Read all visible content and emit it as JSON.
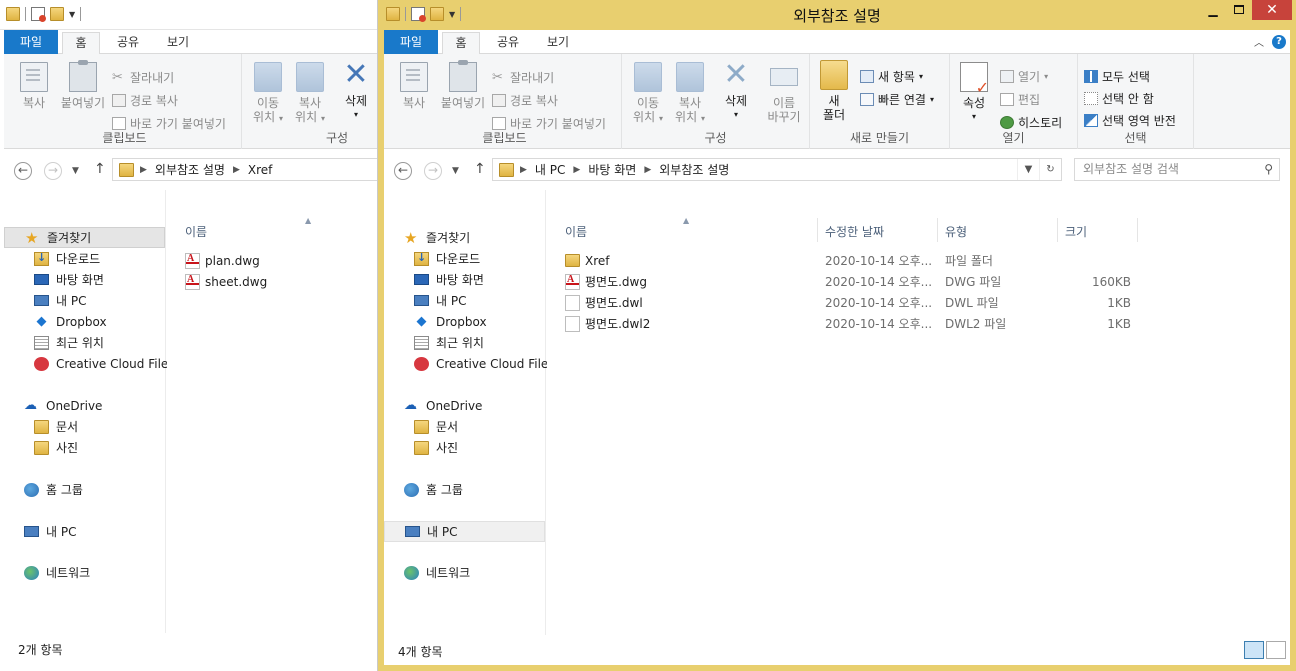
{
  "left_window": {
    "tabs": [
      "파일",
      "홈",
      "공유",
      "보기"
    ],
    "ribbon": {
      "clipboard": {
        "copy": "복사",
        "paste": "붙여넣기",
        "cut": "잘라내기",
        "copy_path": "경로 복사",
        "paste_shortcut": "바로 가기 붙여넣기",
        "label": "클립보드"
      },
      "organize": {
        "move_to": [
          "이동",
          "위치"
        ],
        "copy_to": [
          "복사",
          "위치"
        ],
        "delete": "삭제",
        "label": "구성"
      }
    },
    "breadcrumb": [
      "외부참조 설명",
      "Xref"
    ],
    "nav": {
      "favorites": "즐겨찾기",
      "fav_items": [
        "다운로드",
        "바탕 화면",
        "내 PC",
        "Dropbox",
        "최근 위치",
        "Creative Cloud Files"
      ],
      "onedrive": "OneDrive",
      "onedrive_items": [
        "문서",
        "사진"
      ],
      "homegroup": "홈 그룹",
      "this_pc": "내 PC",
      "network": "네트워크"
    },
    "columns": {
      "name": "이름"
    },
    "files": [
      {
        "name": "plan.dwg",
        "icon": "dwg-file-icon"
      },
      {
        "name": "sheet.dwg",
        "icon": "dwg-file-icon"
      }
    ],
    "status": "2개 항목"
  },
  "right_window": {
    "title": "외부참조 설명",
    "tabs": [
      "파일",
      "홈",
      "공유",
      "보기"
    ],
    "ribbon": {
      "clipboard": {
        "copy": "복사",
        "paste": "붙여넣기",
        "cut": "잘라내기",
        "copy_path": "경로 복사",
        "paste_shortcut": "바로 가기 붙여넣기",
        "label": "클립보드"
      },
      "organize": {
        "move_to": [
          "이동",
          "위치"
        ],
        "copy_to": [
          "복사",
          "위치"
        ],
        "delete": "삭제",
        "rename": [
          "이름",
          "바꾸기"
        ],
        "label": "구성"
      },
      "new": {
        "new_folder": [
          "새",
          "폴더"
        ],
        "new_item": "새 항목",
        "easy_access": "빠른 연결",
        "label": "새로 만들기"
      },
      "open": {
        "properties": "속성",
        "open": "열기",
        "edit": "편집",
        "history": "히스토리",
        "label": "열기"
      },
      "select": {
        "select_all": "모두 선택",
        "select_none": "선택 안 함",
        "invert": "선택 영역 반전",
        "label": "선택"
      }
    },
    "breadcrumb": [
      "내 PC",
      "바탕 화면",
      "외부참조 설명"
    ],
    "search_placeholder": "외부참조 설명 검색",
    "nav": {
      "favorites": "즐겨찾기",
      "fav_items": [
        "다운로드",
        "바탕 화면",
        "내 PC",
        "Dropbox",
        "최근 위치",
        "Creative Cloud Files"
      ],
      "onedrive": "OneDrive",
      "onedrive_items": [
        "문서",
        "사진"
      ],
      "homegroup": "홈 그룹",
      "this_pc": "내 PC",
      "network": "네트워크"
    },
    "columns": {
      "name": "이름",
      "modified": "수정한 날짜",
      "type": "유형",
      "size": "크기"
    },
    "files": [
      {
        "name": "Xref",
        "modified": "2020-10-14 오후...",
        "type": "파일 폴더",
        "size": "",
        "icon": "folder-icon"
      },
      {
        "name": "평면도.dwg",
        "modified": "2020-10-14 오후...",
        "type": "DWG 파일",
        "size": "160KB",
        "icon": "dwg-file-icon"
      },
      {
        "name": "평면도.dwl",
        "modified": "2020-10-14 오후...",
        "type": "DWL 파일",
        "size": "1KB",
        "icon": "blank-file-icon"
      },
      {
        "name": "평면도.dwl2",
        "modified": "2020-10-14 오후...",
        "type": "DWL2 파일",
        "size": "1KB",
        "icon": "blank-file-icon"
      }
    ],
    "status": "4개 항목"
  },
  "colors": {
    "accent": "#1979ca",
    "active_frame": "#e8cf6f",
    "close": "#c7433b"
  }
}
